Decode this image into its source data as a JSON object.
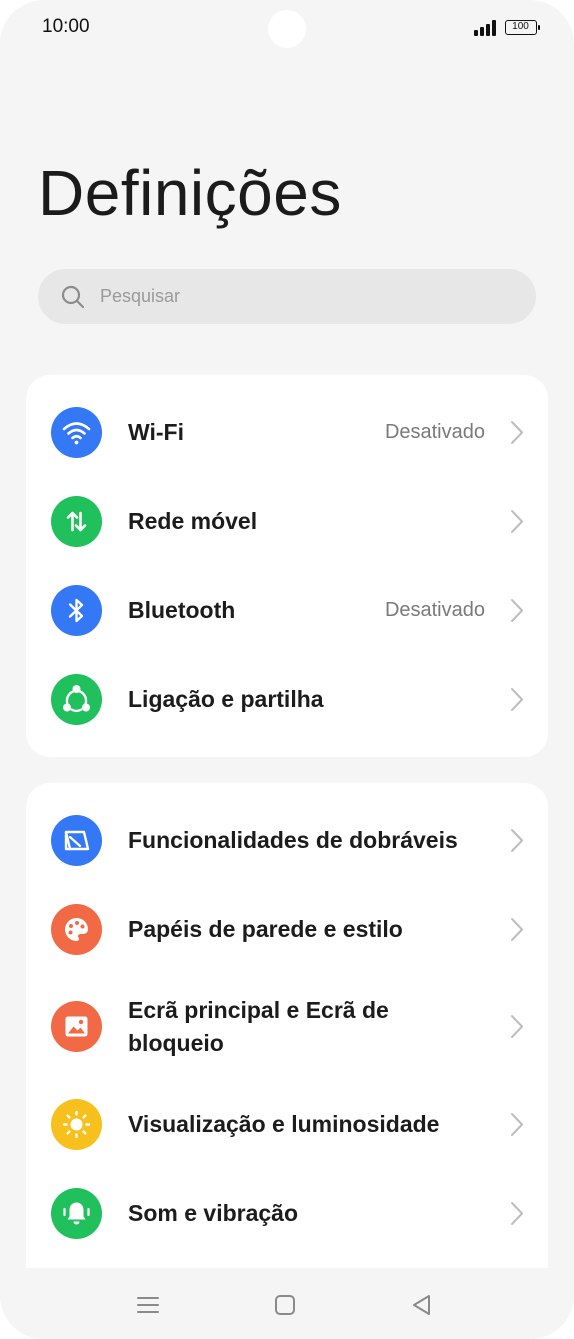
{
  "status": {
    "time": "10:00",
    "battery": "100"
  },
  "title": "Definições",
  "search": {
    "placeholder": "Pesquisar"
  },
  "colors": {
    "blue": "#3478f6",
    "green": "#20c05c",
    "orange": "#f26a45",
    "yellow": "#f7c01c"
  },
  "groups": [
    {
      "items": [
        {
          "label": "Wi-Fi",
          "value": "Desativado",
          "icon": "wifi-icon",
          "color": "#3478f6"
        },
        {
          "label": "Rede móvel",
          "icon": "mobile-data-icon",
          "color": "#20c05c"
        },
        {
          "label": "Bluetooth",
          "value": "Desativado",
          "icon": "bluetooth-icon",
          "color": "#3478f6"
        },
        {
          "label": "Ligação e partilha",
          "icon": "connection-share-icon",
          "color": "#20c05c"
        }
      ]
    },
    {
      "items": [
        {
          "label": "Funcionalidades de dobráveis",
          "icon": "foldable-icon",
          "color": "#3478f6"
        },
        {
          "label": "Papéis de parede e estilo",
          "icon": "palette-icon",
          "color": "#f26a45"
        },
        {
          "label": "Ecrã principal e Ecrã de bloqueio",
          "icon": "home-screen-icon",
          "color": "#f26a45"
        },
        {
          "label": "Visualização e luminosidade",
          "icon": "brightness-icon",
          "color": "#f7c01c"
        },
        {
          "label": "Som e vibração",
          "icon": "bell-icon",
          "color": "#20c05c"
        }
      ]
    }
  ]
}
